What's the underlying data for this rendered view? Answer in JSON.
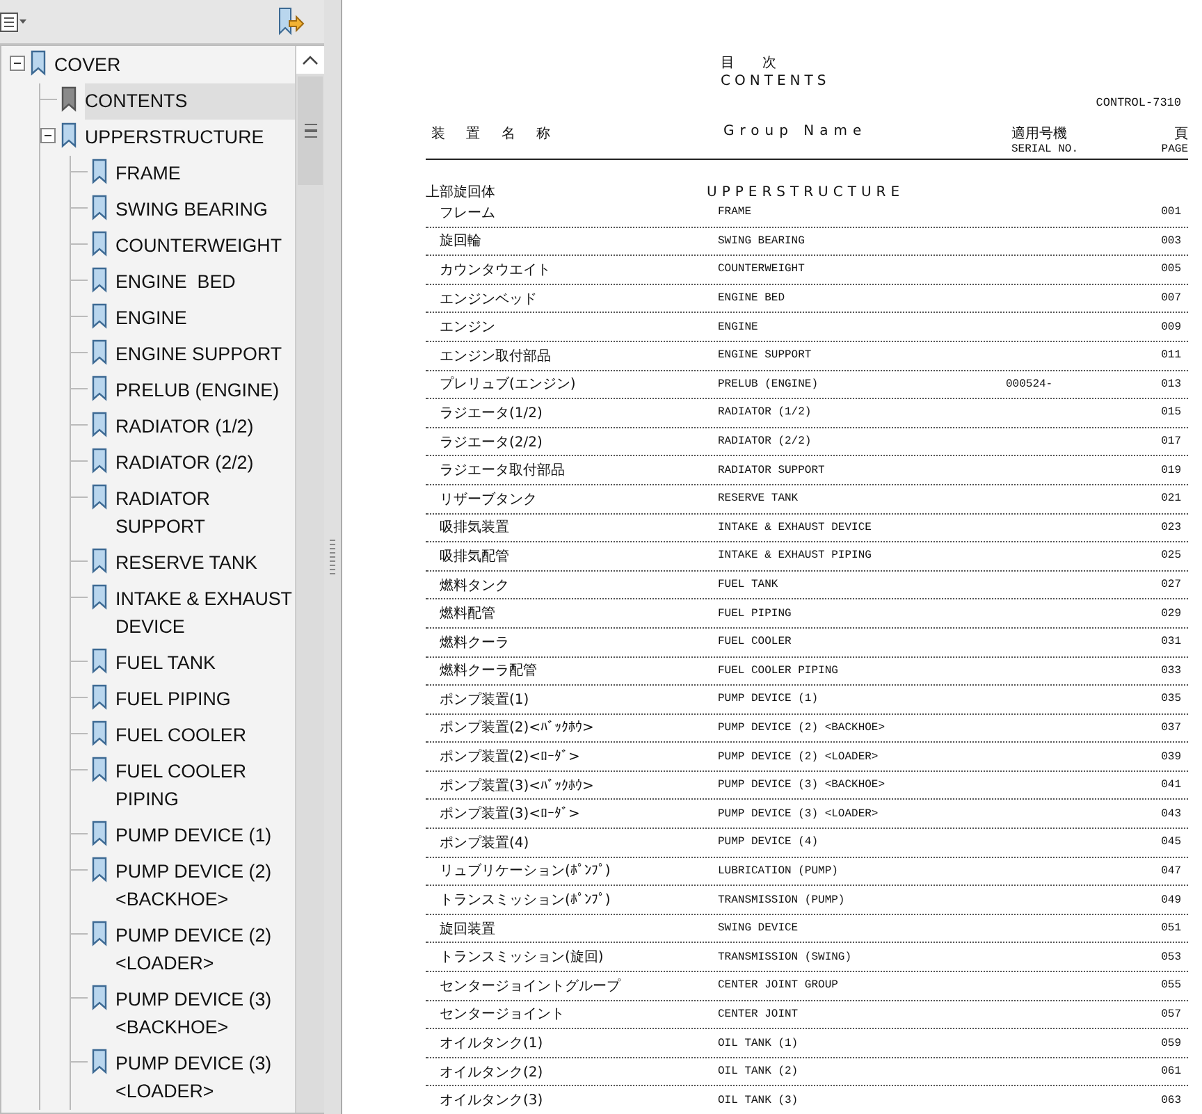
{
  "bookmarks_panel": {
    "tree": [
      {
        "label": "COVER",
        "selected": false,
        "expanded": true,
        "children": [
          {
            "label": "CONTENTS",
            "selected": true
          },
          {
            "label": "UPPERSTRUCTURE",
            "selected": false,
            "expanded": true,
            "children": [
              {
                "label": "FRAME",
                "selected": false
              },
              {
                "label": "SWING BEARING",
                "selected": false
              },
              {
                "label": "COUNTERWEIGHT",
                "selected": false
              },
              {
                "label": "ENGINE  BED",
                "selected": false
              },
              {
                "label": "ENGINE",
                "selected": false
              },
              {
                "label": "ENGINE SUPPORT",
                "selected": false
              },
              {
                "label": "PRELUB (ENGINE)",
                "selected": false
              },
              {
                "label": "RADIATOR (1/2)",
                "selected": false
              },
              {
                "label": "RADIATOR (2/2)",
                "selected": false
              },
              {
                "label": "RADIATOR SUPPORT",
                "selected": false
              },
              {
                "label": "RESERVE TANK",
                "selected": false
              },
              {
                "label": "INTAKE & EXHAUST DEVICE",
                "selected": false
              },
              {
                "label": "FUEL TANK",
                "selected": false
              },
              {
                "label": "FUEL PIPING",
                "selected": false
              },
              {
                "label": "FUEL COOLER",
                "selected": false
              },
              {
                "label": "FUEL COOLER PIPING",
                "selected": false
              },
              {
                "label": "PUMP DEVICE (1)",
                "selected": false
              },
              {
                "label": "PUMP DEVICE (2) <BACKHOE>",
                "selected": false
              },
              {
                "label": "PUMP DEVICE (2) <LOADER>",
                "selected": false
              },
              {
                "label": "PUMP DEVICE (3) <BACKHOE>",
                "selected": false
              },
              {
                "label": "PUMP DEVICE (3) <LOADER>",
                "selected": false
              }
            ]
          }
        ]
      }
    ]
  },
  "document": {
    "title_jp": "目　　次",
    "title": "CONTENTS",
    "control_no": "CONTROL-7310",
    "columns": [
      {
        "jp": "装 置 名 称"
      },
      {
        "en": "Group Name"
      },
      {
        "jp": "適用号機",
        "en": "SERIAL NO."
      },
      {
        "jp": "頁",
        "en": "PAGE"
      }
    ],
    "section": {
      "jp": "上部旋回体",
      "en": "UPPERSTRUCTURE"
    },
    "rows": [
      {
        "jp": "フレーム",
        "en": "FRAME",
        "page": "001"
      },
      {
        "jp": "旋回輪",
        "en": "SWING BEARING",
        "page": "003"
      },
      {
        "jp": "カウンタウエイト",
        "en": "COUNTERWEIGHT",
        "page": "005"
      },
      {
        "jp": "エンジンベッド",
        "en": "ENGINE BED",
        "page": "007"
      },
      {
        "jp": "エンジン",
        "en": "ENGINE",
        "page": "009"
      },
      {
        "jp": "エンジン取付部品",
        "en": "ENGINE SUPPORT",
        "page": "011"
      },
      {
        "jp": "プレリュブ(エンジン)",
        "en": "PRELUB (ENGINE)",
        "serial": "000524-",
        "page": "013"
      },
      {
        "jp": "ラジエータ(1/2)",
        "en": "RADIATOR (1/2)",
        "page": "015"
      },
      {
        "jp": "ラジエータ(2/2)",
        "en": "RADIATOR (2/2)",
        "page": "017"
      },
      {
        "jp": "ラジエータ取付部品",
        "en": "RADIATOR SUPPORT",
        "page": "019"
      },
      {
        "jp": "リザーブタンク",
        "en": "RESERVE TANK",
        "page": "021"
      },
      {
        "jp": "吸排気装置",
        "en": "INTAKE & EXHAUST DEVICE",
        "page": "023"
      },
      {
        "jp": "吸排気配管",
        "en": "INTAKE & EXHAUST PIPING",
        "page": "025"
      },
      {
        "jp": "燃料タンク",
        "en": "FUEL TANK",
        "page": "027"
      },
      {
        "jp": "燃料配管",
        "en": "FUEL PIPING",
        "page": "029"
      },
      {
        "jp": "燃料クーラ",
        "en": "FUEL COOLER",
        "page": "031"
      },
      {
        "jp": "燃料クーラ配管",
        "en": "FUEL COOLER PIPING",
        "page": "033"
      },
      {
        "jp": "ポンプ装置(1)",
        "en": "PUMP DEVICE (1)",
        "page": "035"
      },
      {
        "jp": "ポンプ装置(2)<ﾊﾞｯｸﾎｳ>",
        "en": "PUMP DEVICE (2) <BACKHOE>",
        "page": "037"
      },
      {
        "jp": "ポンプ装置(2)<ﾛｰﾀﾞ>",
        "en": "PUMP DEVICE (2) <LOADER>",
        "page": "039"
      },
      {
        "jp": "ポンプ装置(3)<ﾊﾞｯｸﾎｳ>",
        "en": "PUMP DEVICE (3) <BACKHOE>",
        "page": "041"
      },
      {
        "jp": "ポンプ装置(3)<ﾛｰﾀﾞ>",
        "en": "PUMP DEVICE (3) <LOADER>",
        "page": "043"
      },
      {
        "jp": "ポンプ装置(4)",
        "en": "PUMP DEVICE (4)",
        "page": "045"
      },
      {
        "jp": "リュブリケーション(ﾎﾟﾝﾌﾟ)",
        "en": "LUBRICATION (PUMP)",
        "page": "047"
      },
      {
        "jp": "トランスミッション(ﾎﾟﾝﾌﾟ)",
        "en": "TRANSMISSION (PUMP)",
        "page": "049"
      },
      {
        "jp": "旋回装置",
        "en": "SWING DEVICE",
        "page": "051"
      },
      {
        "jp": "トランスミッション(旋回)",
        "en": "TRANSMISSION (SWING)",
        "page": "053"
      },
      {
        "jp": "センタージョイントグループ",
        "en": "CENTER JOINT GROUP",
        "page": "055"
      },
      {
        "jp": "センタージョイント",
        "en": "CENTER JOINT",
        "page": "057"
      },
      {
        "jp": "オイルタンク(1)",
        "en": "OIL TANK (1)",
        "page": "059"
      },
      {
        "jp": "オイルタンク(2)",
        "en": "OIL TANK (2)",
        "page": "061"
      },
      {
        "jp": "オイルタンク(3)",
        "en": "OIL TANK (3)",
        "page": "063"
      }
    ]
  }
}
